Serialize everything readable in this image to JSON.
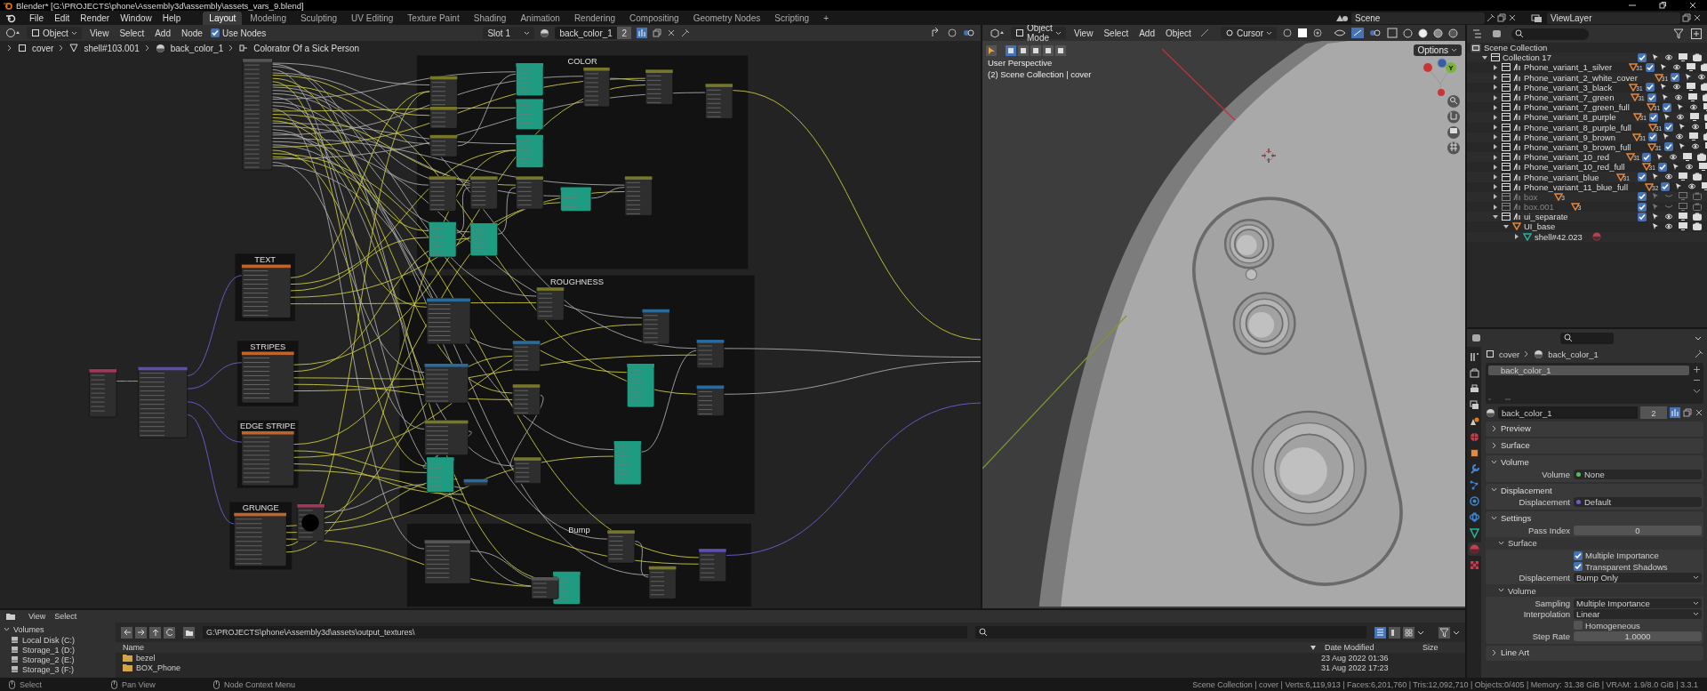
{
  "window": {
    "title": "Blender* [G:\\PROJECTS\\phone\\Assembly3d\\assembly\\assets_vars_9.blend]"
  },
  "topbar": {
    "menus": [
      "File",
      "Edit",
      "Render",
      "Window",
      "Help"
    ],
    "tabs": [
      {
        "label": "Layout",
        "selected": true
      },
      {
        "label": "Modeling",
        "selected": false
      },
      {
        "label": "Sculpting",
        "selected": false
      },
      {
        "label": "UV Editing",
        "selected": false
      },
      {
        "label": "Texture Paint",
        "selected": false
      },
      {
        "label": "Shading",
        "selected": false
      },
      {
        "label": "Animation",
        "selected": false
      },
      {
        "label": "Rendering",
        "selected": false
      },
      {
        "label": "Compositing",
        "selected": false
      },
      {
        "label": "Geometry Nodes",
        "selected": false
      },
      {
        "label": "Scripting",
        "selected": false
      }
    ],
    "add_tab": "+",
    "scene": "Scene",
    "view_layer": "ViewLayer"
  },
  "node_editor": {
    "header": {
      "object_mode": "Object",
      "menus": [
        "View",
        "Select",
        "Add",
        "Node"
      ],
      "use_nodes": {
        "label": "Use Nodes",
        "checked": true
      },
      "slot": "Slot 1",
      "material": "back_color_1",
      "users": "2"
    },
    "breadcrumbs": [
      "cover",
      "shell#103.001",
      "back_color_1",
      "Colorator Of a Sick Person"
    ],
    "frames": [
      {
        "label": "COLOR"
      },
      {
        "label": "ROUGHNESS"
      },
      {
        "label": "Bump"
      },
      {
        "label": "TEXT"
      },
      {
        "label": "STRIPES"
      },
      {
        "label": "EDGE STRIPE"
      },
      {
        "label": "GRUNGE"
      }
    ]
  },
  "viewport": {
    "header": {
      "mode": "Object Mode",
      "menus": [
        "View",
        "Select",
        "Add",
        "Object"
      ],
      "pivot": "Cursor",
      "options": "Options"
    },
    "overlay_lines": [
      "User Perspective",
      "(2) Scene Collection | cover"
    ],
    "gizmo_axis_label": "Y"
  },
  "outliner": {
    "root": "Scene Collection",
    "items": [
      {
        "label": "Collection 17",
        "kind": "collection",
        "expanded": true,
        "checked": true,
        "children": [
          {
            "label": "Phone_variant_1_silver",
            "kind": "subcollection",
            "expanded": false,
            "disabled": false,
            "checked": true,
            "count": "31"
          },
          {
            "label": "Phone_variant_2_white_cover",
            "kind": "subcollection",
            "expanded": false,
            "disabled": false,
            "checked": true,
            "count": "31"
          },
          {
            "label": "Phone_variant_3_black",
            "kind": "subcollection",
            "expanded": false,
            "disabled": false,
            "checked": true,
            "count": "31"
          },
          {
            "label": "Phone_variant_7_green",
            "kind": "subcollection",
            "expanded": false,
            "disabled": false,
            "checked": true,
            "count": "31"
          },
          {
            "label": "Phone_variant_7_green_full",
            "kind": "subcollection",
            "expanded": false,
            "disabled": false,
            "checked": true,
            "count": "31"
          },
          {
            "label": "Phone_variant_8_purple",
            "kind": "subcollection",
            "expanded": false,
            "disabled": false,
            "checked": true,
            "count": "31"
          },
          {
            "label": "Phone_variant_8_purple_full",
            "kind": "subcollection",
            "expanded": false,
            "disabled": false,
            "checked": true,
            "count": "31"
          },
          {
            "label": "Phone_variant_9_brown",
            "kind": "subcollection",
            "expanded": false,
            "disabled": false,
            "checked": true,
            "count": "31"
          },
          {
            "label": "Phone_variant_9_brown_full",
            "kind": "subcollection",
            "expanded": false,
            "disabled": false,
            "checked": true,
            "count": "31"
          },
          {
            "label": "Phone_variant_10_red",
            "kind": "subcollection",
            "expanded": false,
            "disabled": false,
            "checked": true,
            "count": "31"
          },
          {
            "label": "Phone_variant_10_red_full",
            "kind": "subcollection",
            "expanded": false,
            "disabled": false,
            "checked": true,
            "count": "31"
          },
          {
            "label": "Phone_variant_blue",
            "kind": "subcollection",
            "expanded": false,
            "disabled": false,
            "checked": true,
            "count": "31"
          },
          {
            "label": "Phone_variant_11_blue_full",
            "kind": "subcollection",
            "expanded": false,
            "disabled": false,
            "checked": true,
            "count": "32"
          },
          {
            "label": "box",
            "kind": "subcollection",
            "expanded": false,
            "disabled": true,
            "checked": true,
            "count": "3"
          },
          {
            "label": "box.001",
            "kind": "subcollection",
            "expanded": false,
            "disabled": true,
            "checked": true,
            "count": "3"
          },
          {
            "label": "ui_separate",
            "kind": "subcollection",
            "expanded": true,
            "disabled": false,
            "checked": true,
            "children": [
              {
                "label": "UI_base",
                "kind": "empty",
                "expanded": true,
                "children": [
                  {
                    "label": "shell#42.023",
                    "kind": "mesh",
                    "expanded": false
                  }
                ]
              }
            ]
          }
        ]
      }
    ]
  },
  "properties": {
    "tabs": [
      {
        "kind": "tool",
        "selected": false
      },
      {
        "kind": "render",
        "selected": false
      },
      {
        "kind": "output",
        "selected": false
      },
      {
        "kind": "view_layer",
        "selected": false
      },
      {
        "kind": "scene",
        "selected": false
      },
      {
        "kind": "world",
        "selected": false
      },
      {
        "kind": "object",
        "selected": false
      },
      {
        "kind": "modifiers",
        "selected": false
      },
      {
        "kind": "particles",
        "selected": false
      },
      {
        "kind": "physics",
        "selected": false
      },
      {
        "kind": "constraints",
        "selected": false
      },
      {
        "kind": "data",
        "selected": false
      },
      {
        "kind": "material",
        "selected": true
      },
      {
        "kind": "texture",
        "selected": false
      }
    ],
    "breadcrumbs": [
      "cover",
      "back_color_1"
    ],
    "slots": [
      {
        "label": "back_color_1",
        "selected": true
      }
    ],
    "material": "back_color_1",
    "users": "2",
    "panels": [
      {
        "title": "Preview",
        "expanded": false
      },
      {
        "title": "Surface",
        "expanded": false
      },
      {
        "title": "Volume",
        "expanded": true,
        "rows": [
          {
            "kind": "socket",
            "label": "Volume",
            "value": "None",
            "color": "#4fc24f"
          }
        ]
      },
      {
        "title": "Displacement",
        "expanded": true,
        "rows": [
          {
            "kind": "socket",
            "label": "Displacement",
            "value": "Default",
            "color": "#6363c7"
          }
        ]
      },
      {
        "title": "Settings",
        "expanded": true,
        "rows": [
          {
            "kind": "number",
            "label": "Pass Index",
            "value": "0"
          },
          {
            "kind": "subpanel",
            "title": "Surface",
            "expanded": true
          },
          {
            "kind": "checkbox",
            "label": "Multiple Importance",
            "checked": true
          },
          {
            "kind": "checkbox",
            "label": "Transparent Shadows",
            "checked": true
          },
          {
            "kind": "dropdown",
            "label": "Displacement",
            "value": "Bump Only"
          },
          {
            "kind": "subpanel",
            "title": "Volume",
            "expanded": true
          },
          {
            "kind": "dropdown",
            "label": "Sampling",
            "value": "Multiple Importance"
          },
          {
            "kind": "dropdown",
            "label": "Interpolation",
            "value": "Linear"
          },
          {
            "kind": "checkbox",
            "label": "Homogeneous",
            "checked": false
          },
          {
            "kind": "number",
            "label": "Step Rate",
            "value": "1.0000"
          }
        ]
      },
      {
        "title": "Line Art",
        "expanded": false
      }
    ]
  },
  "file_browser": {
    "menus": [
      "View",
      "Select"
    ],
    "volumes_title": "Volumes",
    "volumes": [
      "Local Disk (C:)",
      "Storage_1 (D:)",
      "Storage_2 (E:)",
      "Storage_3 (F:)"
    ],
    "path": "G:\\PROJECTS\\phone\\Assembly3d\\assets\\output_textures\\",
    "columns": [
      "Name",
      "Date Modified",
      "Size"
    ],
    "files": [
      {
        "name": "bezel",
        "modified": "23 Aug 2022 01:36"
      },
      {
        "name": "BOX_Phone",
        "modified": "31 Aug 2022 17:23"
      }
    ]
  },
  "status_bar": {
    "hints": [
      "Select",
      "Pan View",
      "Node Context Menu"
    ],
    "stats": "Scene Collection | cover | Verts:6,119,913 | Faces:6,201,760 | Tris:12,092,710 | Objects:0/405 | Memory: 31.38 GiB | VRAM: 1.9/8.0 GiB | 3.3.1"
  }
}
